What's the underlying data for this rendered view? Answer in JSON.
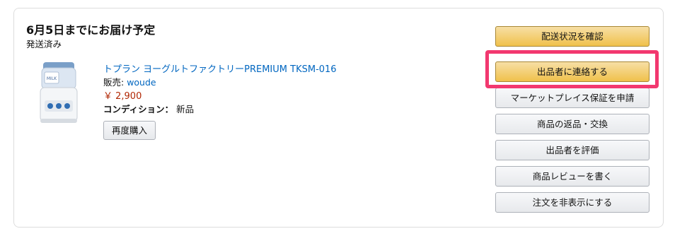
{
  "shipment": {
    "delivery_title": "6月5日までにお届け予定",
    "status": "発送済み"
  },
  "product": {
    "image_icon": "yogurt-maker-product-image",
    "image_label": "MILK",
    "title": "トプラン ヨーグルトファクトリーPREMIUM TKSM-016",
    "seller_prefix": "販売: ",
    "seller_name": "woude",
    "price": "￥ 2,900",
    "condition_label": "コンディション：",
    "condition_value": "新品",
    "buy_again_label": "再度購入"
  },
  "actions": {
    "track_package": "配送状況を確認",
    "contact_seller": "出品者に連絡する",
    "marketplace_guarantee": "マーケットプレイス保証を申請",
    "return_items": "商品の返品・交換",
    "rate_seller": "出品者を評価",
    "write_review": "商品レビューを書く",
    "hide_order": "注文を非表示にする"
  },
  "colors": {
    "link": "#0066c0",
    "price": "#b12704",
    "primary_button": "#f0c14b",
    "highlight": "#f2386f"
  }
}
